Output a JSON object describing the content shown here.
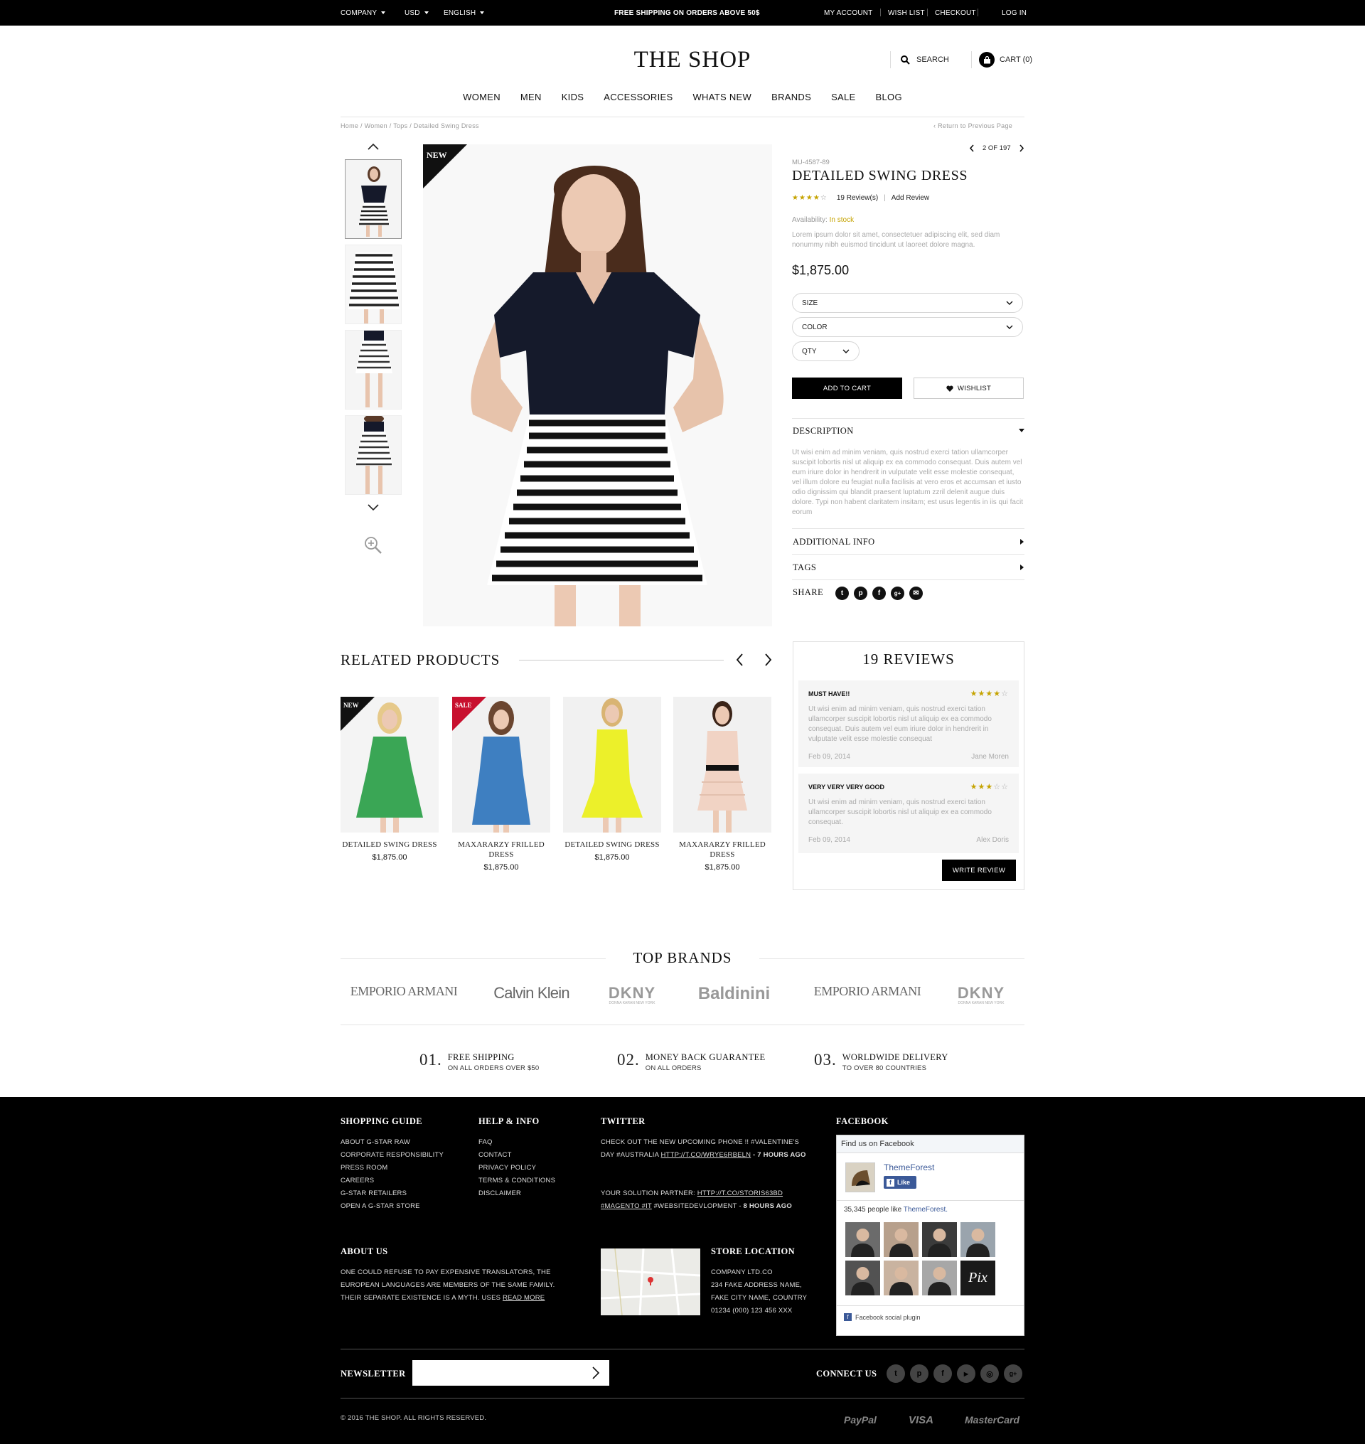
{
  "topbar": {
    "company": "COMPANY",
    "currency": "USD",
    "language": "ENGLISH",
    "promo": "FREE SHIPPING ON ORDERS ABOVE 50$",
    "my_account": "MY ACCOUNT",
    "wish_list": "WISH LIST",
    "checkout": "CHECKOUT",
    "login": "LOG IN"
  },
  "header": {
    "logo": "THE SHOP",
    "search": "SEARCH",
    "cart": "CART (0)"
  },
  "nav": [
    "WOMEN",
    "MEN",
    "KIDS",
    "ACCESSORIES",
    "WHATS NEW",
    "BRANDS",
    "SALE",
    "BLOG"
  ],
  "breadcrumb": {
    "path": "Home  /  Women  /  Tops  /  Detailed Swing Dress",
    "back": "Return to Previous Page"
  },
  "gallery": {
    "badge": "NEW",
    "thumbnail_count": 4
  },
  "product": {
    "pager": "2 OF 197",
    "sku": "MU-4587-89",
    "title": "DETAILED SWING DRESS",
    "rating": 4,
    "reviews_link": "19 Review(s)",
    "add_review": "Add Review",
    "availability_label": "Availability:",
    "availability_value": "In stock",
    "short_desc": "Lorem ipsum dolor sit amet, consectetuer adipiscing elit, sed diam nonummy nibh euismod tincidunt ut laoreet dolore magna.",
    "price": "$1,875.00",
    "size_label": "SIZE",
    "color_label": "COLOR",
    "qty_label": "QTY",
    "add_to_cart": "ADD TO CART",
    "wishlist": "WISHLIST",
    "description_title": "DESCRIPTION",
    "description": "Ut wisi enim ad minim veniam, quis nostrud exerci tation ullamcorper suscipit lobortis nisl ut aliquip ex ea commodo consequat. Duis autem vel eum iriure dolor in hendrerit in vulputate velit esse molestie consequat, vel illum dolore eu feugiat nulla facilisis at vero eros et accumsan et iusto odio dignissim qui blandit praesent luptatum zzril delenit augue duis dolore. Typi non habent claritatem insitam; est usus legentis in iis qui facit eorum",
    "additional_info": "ADDITIONAL INFO",
    "tags": "TAGS",
    "share": "SHARE",
    "share_icons": [
      "twitter-icon",
      "pinterest-icon",
      "facebook-icon",
      "google-plus-icon",
      "email-icon"
    ]
  },
  "related": {
    "title": "RELATED PRODUCTS",
    "items": [
      {
        "name": "DETAILED SWING DRESS",
        "price": "$1,875.00",
        "badge": "NEW",
        "dress_color": "#3aa655",
        "badge_color": "#111111"
      },
      {
        "name": "MAXARARZY FRILLED DRESS",
        "price": "$1,875.00",
        "badge": "SALE",
        "dress_color": "#3e7fc1",
        "badge_color": "#c8102e"
      },
      {
        "name": "DETAILED SWING DRESS",
        "price": "$1,875.00",
        "badge": "",
        "dress_color": "#ecf02a",
        "badge_color": ""
      },
      {
        "name": "MAXARARZY FRILLED DRESS",
        "price": "$1,875.00",
        "badge": "",
        "dress_color": "#f1d3c4",
        "badge_color": ""
      }
    ]
  },
  "reviews": {
    "title": "19 REVIEWS",
    "items": [
      {
        "title": "MUST HAVE!!",
        "stars": 4,
        "body": "Ut wisi enim ad minim veniam, quis nostrud exerci tation ullamcorper suscipit lobortis nisl ut aliquip ex ea commodo consequat. Duis autem vel eum iriure dolor in hendrerit in vulputate velit esse molestie consequat",
        "date": "Feb 09, 2014",
        "author": "Jane Moren"
      },
      {
        "title": "VERY VERY VERY GOOD",
        "stars": 3,
        "body": "Ut wisi enim ad minim veniam, quis nostrud exerci tation ullamcorper suscipit lobortis nisl ut aliquip ex ea commodo consequat.",
        "date": "Feb 09, 2014",
        "author": "Alex Doris"
      }
    ],
    "write_review": "WRITE REVIEW"
  },
  "brands": {
    "title": "TOP BRANDS",
    "items": [
      "EMPORIO ARMANI",
      "Calvin Klein",
      "DKNY",
      "Baldinini",
      "EMPORIO ARMANI",
      "DKNY"
    ],
    "dkny_sub": "DONNA KARAN NEW YORK"
  },
  "features": [
    {
      "num": "01.",
      "title": "FREE SHIPPING",
      "sub": "ON ALL ORDERS OVER $50"
    },
    {
      "num": "02.",
      "title": "MONEY BACK GUARANTEE",
      "sub": "ON ALL ORDERS"
    },
    {
      "num": "03.",
      "title": "WORLDWIDE DELIVERY",
      "sub": "TO OVER 80 COUNTRIES"
    }
  ],
  "footer": {
    "shopping_guide": {
      "title": "SHOPPING GUIDE",
      "links": [
        "ABOUT G-STAR RAW",
        "CORPORATE RESPONSIBILITY",
        "PRESS ROOM",
        "CAREERS",
        "G-STAR RETAILERS",
        "OPEN A G-STAR STORE"
      ]
    },
    "help": {
      "title": "HELP & INFO",
      "links": [
        "FAQ",
        "CONTACT",
        "PRIVACY POLICY",
        "TERMS & CONDITIONS",
        "DISCLAIMER"
      ]
    },
    "twitter": {
      "title": "TWITTER",
      "tweet1_text": "CHECK OUT THE NEW UPCOMING PHONE !! #VALENTINE'S DAY #AUSTRALIA ",
      "tweet1_link": "HTTP://T.CO/WRYE6RBELN",
      "tweet1_time": " - 7 HOURS AGO",
      "tweet2_text": "YOUR SOLUTION PARTNER: ",
      "tweet2_link": "HTTP://T.CO/STORIS63BD",
      "tweet2_tags": "#MAGENTO #IT",
      "tweet2_tail": " #WEBSITEDEVLOPMENT - ",
      "tweet2_time": "8 HOURS AGO"
    },
    "facebook": {
      "title": "FACEBOOK",
      "find_us": "Find us on Facebook",
      "page_name": "ThemeForest",
      "like": "Like",
      "likes_text": "35,345 people like ",
      "likes_page": "ThemeForest.",
      "plugin": "Facebook social plugin",
      "fan_colors": [
        "#6b6b6b",
        "#b7a08c",
        "#3b3b3b",
        "#9aa4ad",
        "#525252",
        "#c9b3a0",
        "#a7a7a7",
        "#1a1a1a"
      ],
      "fan_last": "Pix"
    },
    "about": {
      "title": "ABOUT US",
      "text": "ONE COULD REFUSE TO PAY EXPENSIVE TRANSLATORS, THE EUROPEAN LANGUAGES ARE MEMBERS OF THE SAME FAMILY. THEIR SEPARATE EXISTENCE IS A MYTH. USES ",
      "read_more": "READ MORE"
    },
    "store": {
      "title": "STORE LOCATION",
      "lines": [
        "COMPANY LTD.CO",
        "234 FAKE ADDRESS NAME,",
        "FAKE CITY NAME, COUNTRY",
        "01234 (000) 123 456 XXX"
      ]
    },
    "newsletter": {
      "title": "NEWSLETTER",
      "placeholder": ""
    },
    "connect": {
      "title": "CONNECT US",
      "icons": [
        "twitter-icon",
        "pinterest-icon",
        "facebook-icon",
        "youtube-icon",
        "instagram-icon",
        "google-plus-icon"
      ]
    },
    "copyright": "© 2016 THE SHOP. ALL RIGHTS RESERVED.",
    "payments": [
      "PayPal",
      "VISA",
      "MasterCard"
    ]
  }
}
